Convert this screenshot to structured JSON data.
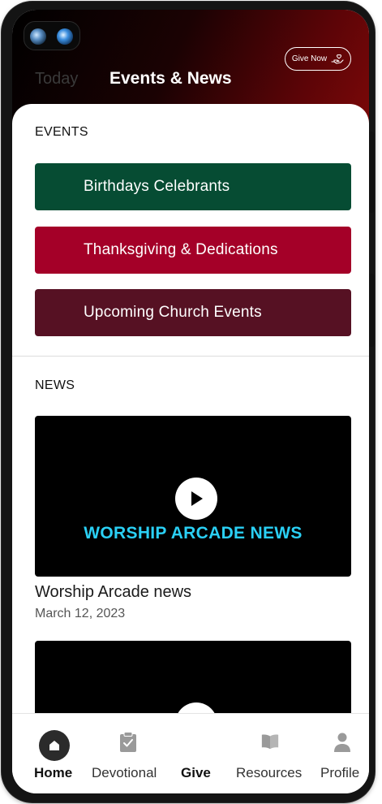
{
  "header": {
    "give_now_label": "Give Now",
    "tab_today": "Today",
    "tab_events_news": "Events & News",
    "gradient_colors": [
      "#000000",
      "#7a0808"
    ]
  },
  "events": {
    "section_title": "EVENTS",
    "buttons": [
      {
        "label": "Birthdays Celebrants",
        "color": "#064c33"
      },
      {
        "label": "Thanksgiving & Dedications",
        "color": "#a40028"
      },
      {
        "label": "Upcoming Church Events",
        "color": "#561123"
      }
    ]
  },
  "news": {
    "section_title": "NEWS",
    "items": [
      {
        "thumbnail_caption": "WORSHIP ARCADE NEWS",
        "title": "Worship Arcade news",
        "date": "March 12, 2023"
      }
    ]
  },
  "bottom_nav": {
    "items": [
      {
        "label": "Home",
        "icon": "home-icon",
        "active": true
      },
      {
        "label": "Devotional",
        "icon": "clipboard-check-icon",
        "active": false
      },
      {
        "label": "Give",
        "icon": "",
        "active": false
      },
      {
        "label": "Resources",
        "icon": "book-icon",
        "active": false
      },
      {
        "label": "Profile",
        "icon": "person-icon",
        "active": false
      }
    ]
  },
  "colors": {
    "accent_cyan": "#2ad0f5"
  }
}
